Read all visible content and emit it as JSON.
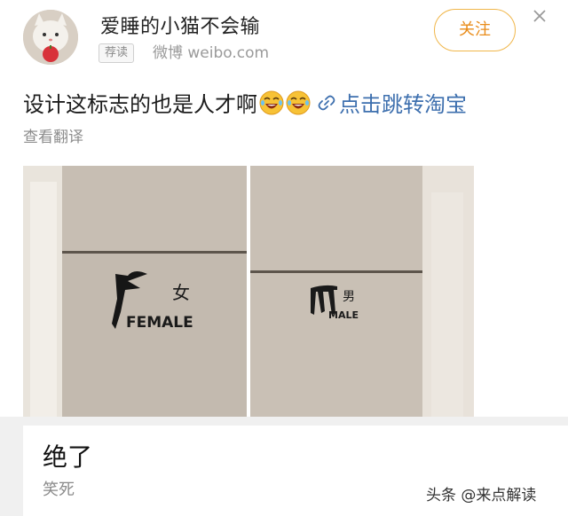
{
  "header": {
    "username": "爱睡的小猫不会输",
    "tag": "荐读",
    "source": "微博 weibo.com",
    "follow_label": "关注"
  },
  "post": {
    "text": "设计这标志的也是人才啊",
    "emoji_icon": "laughing-crying-emoji",
    "link_label": "点击跳转淘宝",
    "translate_label": "查看翻译",
    "images": [
      {
        "sign_label_cn": "女",
        "sign_label_en": "FEMALE"
      },
      {
        "sign_label_cn": "男",
        "sign_label_en": "MALE"
      }
    ]
  },
  "reply": {
    "title": "绝了",
    "subtitle": "笑死"
  },
  "watermark": "头条 @来点解读",
  "colors": {
    "follow_border": "#f0b64a",
    "follow_text": "#e98c1a",
    "link": "#3d6fae"
  }
}
